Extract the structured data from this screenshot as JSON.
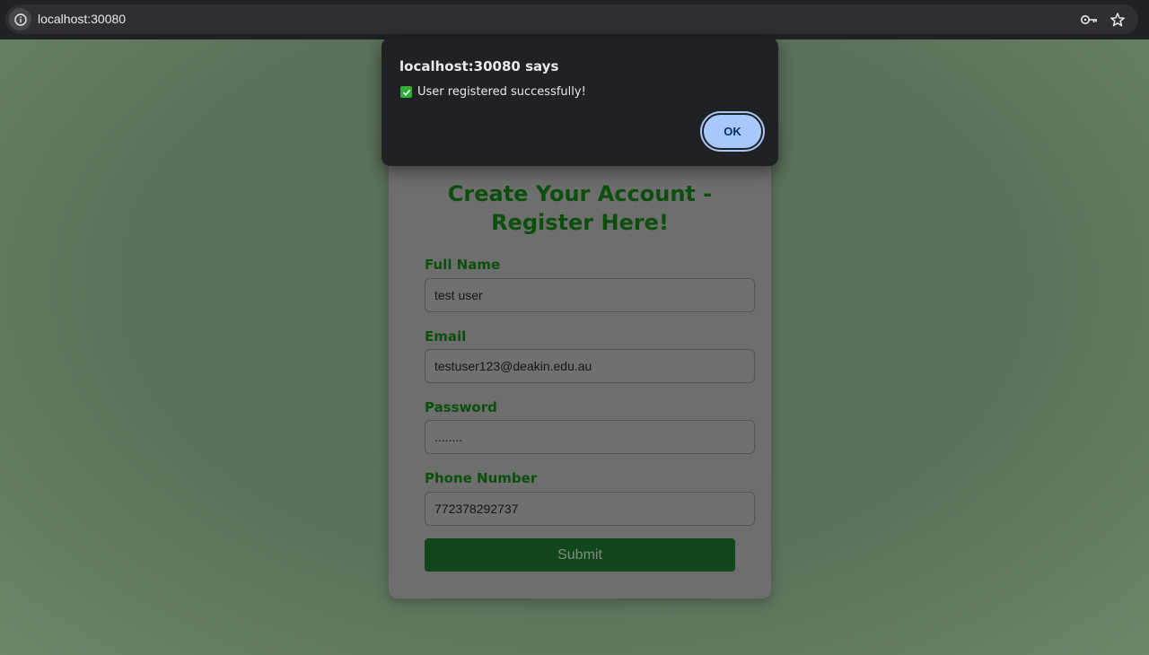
{
  "browser": {
    "url": "localhost:30080"
  },
  "form": {
    "title": "Create Your Account - Register Here!",
    "fields": [
      {
        "label": "Full Name",
        "value": "test user"
      },
      {
        "label": "Email",
        "value": "testuser123@deakin.edu.au"
      },
      {
        "label": "Password",
        "value": "........"
      },
      {
        "label": "Phone Number",
        "value": "772378292737"
      }
    ],
    "submit_label": "Submit"
  },
  "dialog": {
    "title": "localhost:30080 says",
    "message": "User registered successfully!",
    "ok_label": "OK"
  },
  "colors": {
    "accent_green": "#0c4f0c",
    "dialog_button": "#a8c7fa"
  }
}
